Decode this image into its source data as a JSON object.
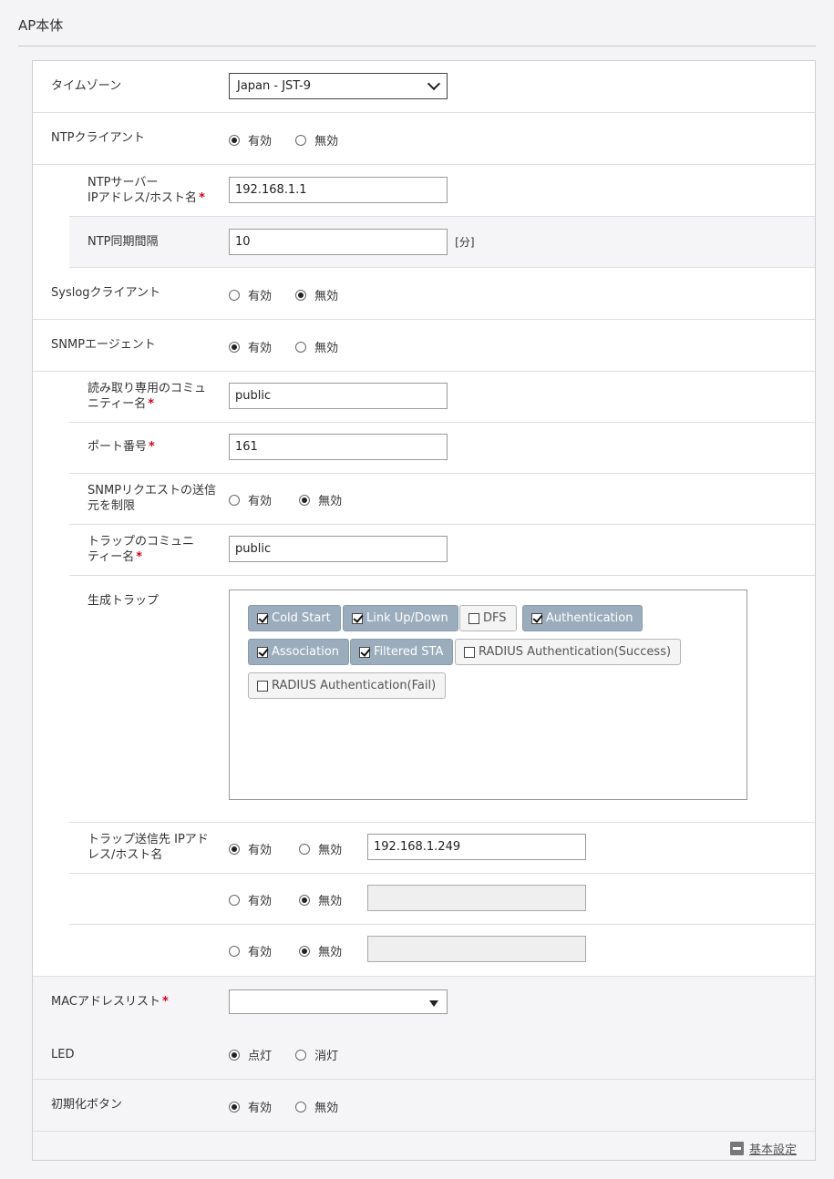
{
  "section": {
    "title": "AP本体"
  },
  "radio_labels": {
    "enable": "有効",
    "disable": "無効",
    "on": "点灯",
    "off": "消灯"
  },
  "timezone": {
    "label": "タイムゾーン",
    "value": "Japan - JST-9"
  },
  "ntp": {
    "label": "NTPクライアント",
    "state": "有効",
    "server_label_1": "NTPサーバー",
    "server_label_2": "IPアドレス/ホスト名",
    "server_value": "192.168.1.1",
    "interval_label": "NTP同期間隔",
    "interval_value": "10",
    "interval_unit": "[分]"
  },
  "syslog": {
    "label": "Syslogクライアント",
    "state": "無効"
  },
  "snmp": {
    "label": "SNMPエージェント",
    "state": "有効",
    "ro_label_1": "読み取り専用のコミュ",
    "ro_label_2": "ニティー名",
    "ro_value": "public",
    "port_label": "ポート番号",
    "port_value": "161",
    "restrict_label_1": "SNMPリクエストの送信",
    "restrict_label_2": "元を制限",
    "restrict_state": "無効",
    "trap_comm_label_1": "トラップのコミュニ",
    "trap_comm_label_2": "ティー名",
    "trap_comm_value": "public",
    "traps_label": "生成トラップ",
    "traps": [
      {
        "name": "Cold Start",
        "checked": true
      },
      {
        "name": "Link Up/Down",
        "checked": true
      },
      {
        "name": "DFS",
        "checked": false
      },
      {
        "name": "Authentication",
        "checked": true
      },
      {
        "name": "Association",
        "checked": true
      },
      {
        "name": "Filtered STA",
        "checked": true
      },
      {
        "name": "RADIUS Authentication(Success)",
        "checked": false
      },
      {
        "name": "RADIUS Authentication(Fail)",
        "checked": false
      }
    ],
    "dest_label_1": "トラップ送信先 IPアド",
    "dest_label_2": "レス/ホスト名",
    "destinations": [
      {
        "state": "有効",
        "value": "192.168.1.249"
      },
      {
        "state": "無効",
        "value": ""
      },
      {
        "state": "無効",
        "value": ""
      }
    ]
  },
  "mac_list": {
    "label": "MACアドレスリスト",
    "value": ""
  },
  "led": {
    "label": "LED",
    "state": "点灯"
  },
  "reset_button": {
    "label": "初期化ボタン",
    "state": "有効"
  },
  "footer": {
    "link_label": "基本設定"
  },
  "required_mark": "*"
}
